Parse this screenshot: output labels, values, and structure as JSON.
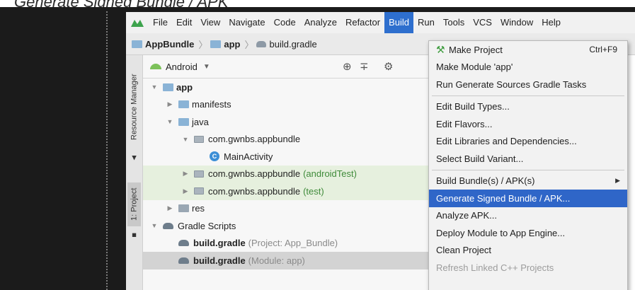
{
  "caption": "Generate Signed Bundle / APK",
  "menubar": {
    "items": [
      "File",
      "Edit",
      "View",
      "Navigate",
      "Code",
      "Analyze",
      "Refactor",
      "Build",
      "Run",
      "Tools",
      "VCS",
      "Window",
      "Help"
    ],
    "active": "Build"
  },
  "breadcrumb": {
    "items": [
      "AppBundle",
      "app",
      "build.gradle"
    ]
  },
  "side_strip": {
    "resource_manager": "Resource Manager",
    "project": "1: Project"
  },
  "project_panel": {
    "view_selector": "Android"
  },
  "tree": [
    {
      "label": "app",
      "suffix": "",
      "indent": 0,
      "icon": "module-folder",
      "expanded": true
    },
    {
      "label": "manifests",
      "suffix": "",
      "indent": 1,
      "icon": "folder",
      "expanded": false
    },
    {
      "label": "java",
      "suffix": "",
      "indent": 1,
      "icon": "folder",
      "expanded": true
    },
    {
      "label": "com.gwnbs.appbundle",
      "suffix": "",
      "indent": 2,
      "icon": "package",
      "expanded": true
    },
    {
      "label": "MainActivity",
      "suffix": "",
      "indent": 3,
      "icon": "class",
      "expanded": null
    },
    {
      "label": "com.gwnbs.appbundle",
      "suffix": "(androidTest)",
      "indent": 2,
      "icon": "package",
      "expanded": false
    },
    {
      "label": "com.gwnbs.appbundle",
      "suffix": "(test)",
      "indent": 2,
      "icon": "package",
      "expanded": false
    },
    {
      "label": "res",
      "suffix": "",
      "indent": 1,
      "icon": "res-folder",
      "expanded": false
    },
    {
      "label": "Gradle Scripts",
      "suffix": "",
      "indent": 0,
      "icon": "gradle",
      "expanded": true
    },
    {
      "label": "build.gradle",
      "suffix": "(Project: App_Bundle)",
      "indent": 1,
      "icon": "gradle",
      "expanded": null
    },
    {
      "label": "build.gradle",
      "suffix": "(Module: app)",
      "indent": 1,
      "icon": "gradle",
      "expanded": null
    }
  ],
  "build_menu": {
    "make_project": "Make Project",
    "make_project_shortcut": "Ctrl+F9",
    "make_module": "Make Module 'app'",
    "run_generate_sources": "Run Generate Sources Gradle Tasks",
    "edit_build_types": "Edit Build Types...",
    "edit_flavors": "Edit Flavors...",
    "edit_libraries": "Edit Libraries and Dependencies...",
    "select_build_variant": "Select Build Variant...",
    "build_bundles": "Build Bundle(s) / APK(s)",
    "generate_signed": "Generate Signed Bundle / APK...",
    "analyze_apk": "Analyze APK...",
    "deploy_module": "Deploy Module to App Engine...",
    "clean_project": "Clean Project",
    "refresh_linked": "Refresh Linked C++ Projects"
  },
  "colors": {
    "menu_highlight": "#2f66c8",
    "green_row": "#e6f0de",
    "selected_row": "#d3d3d3"
  }
}
